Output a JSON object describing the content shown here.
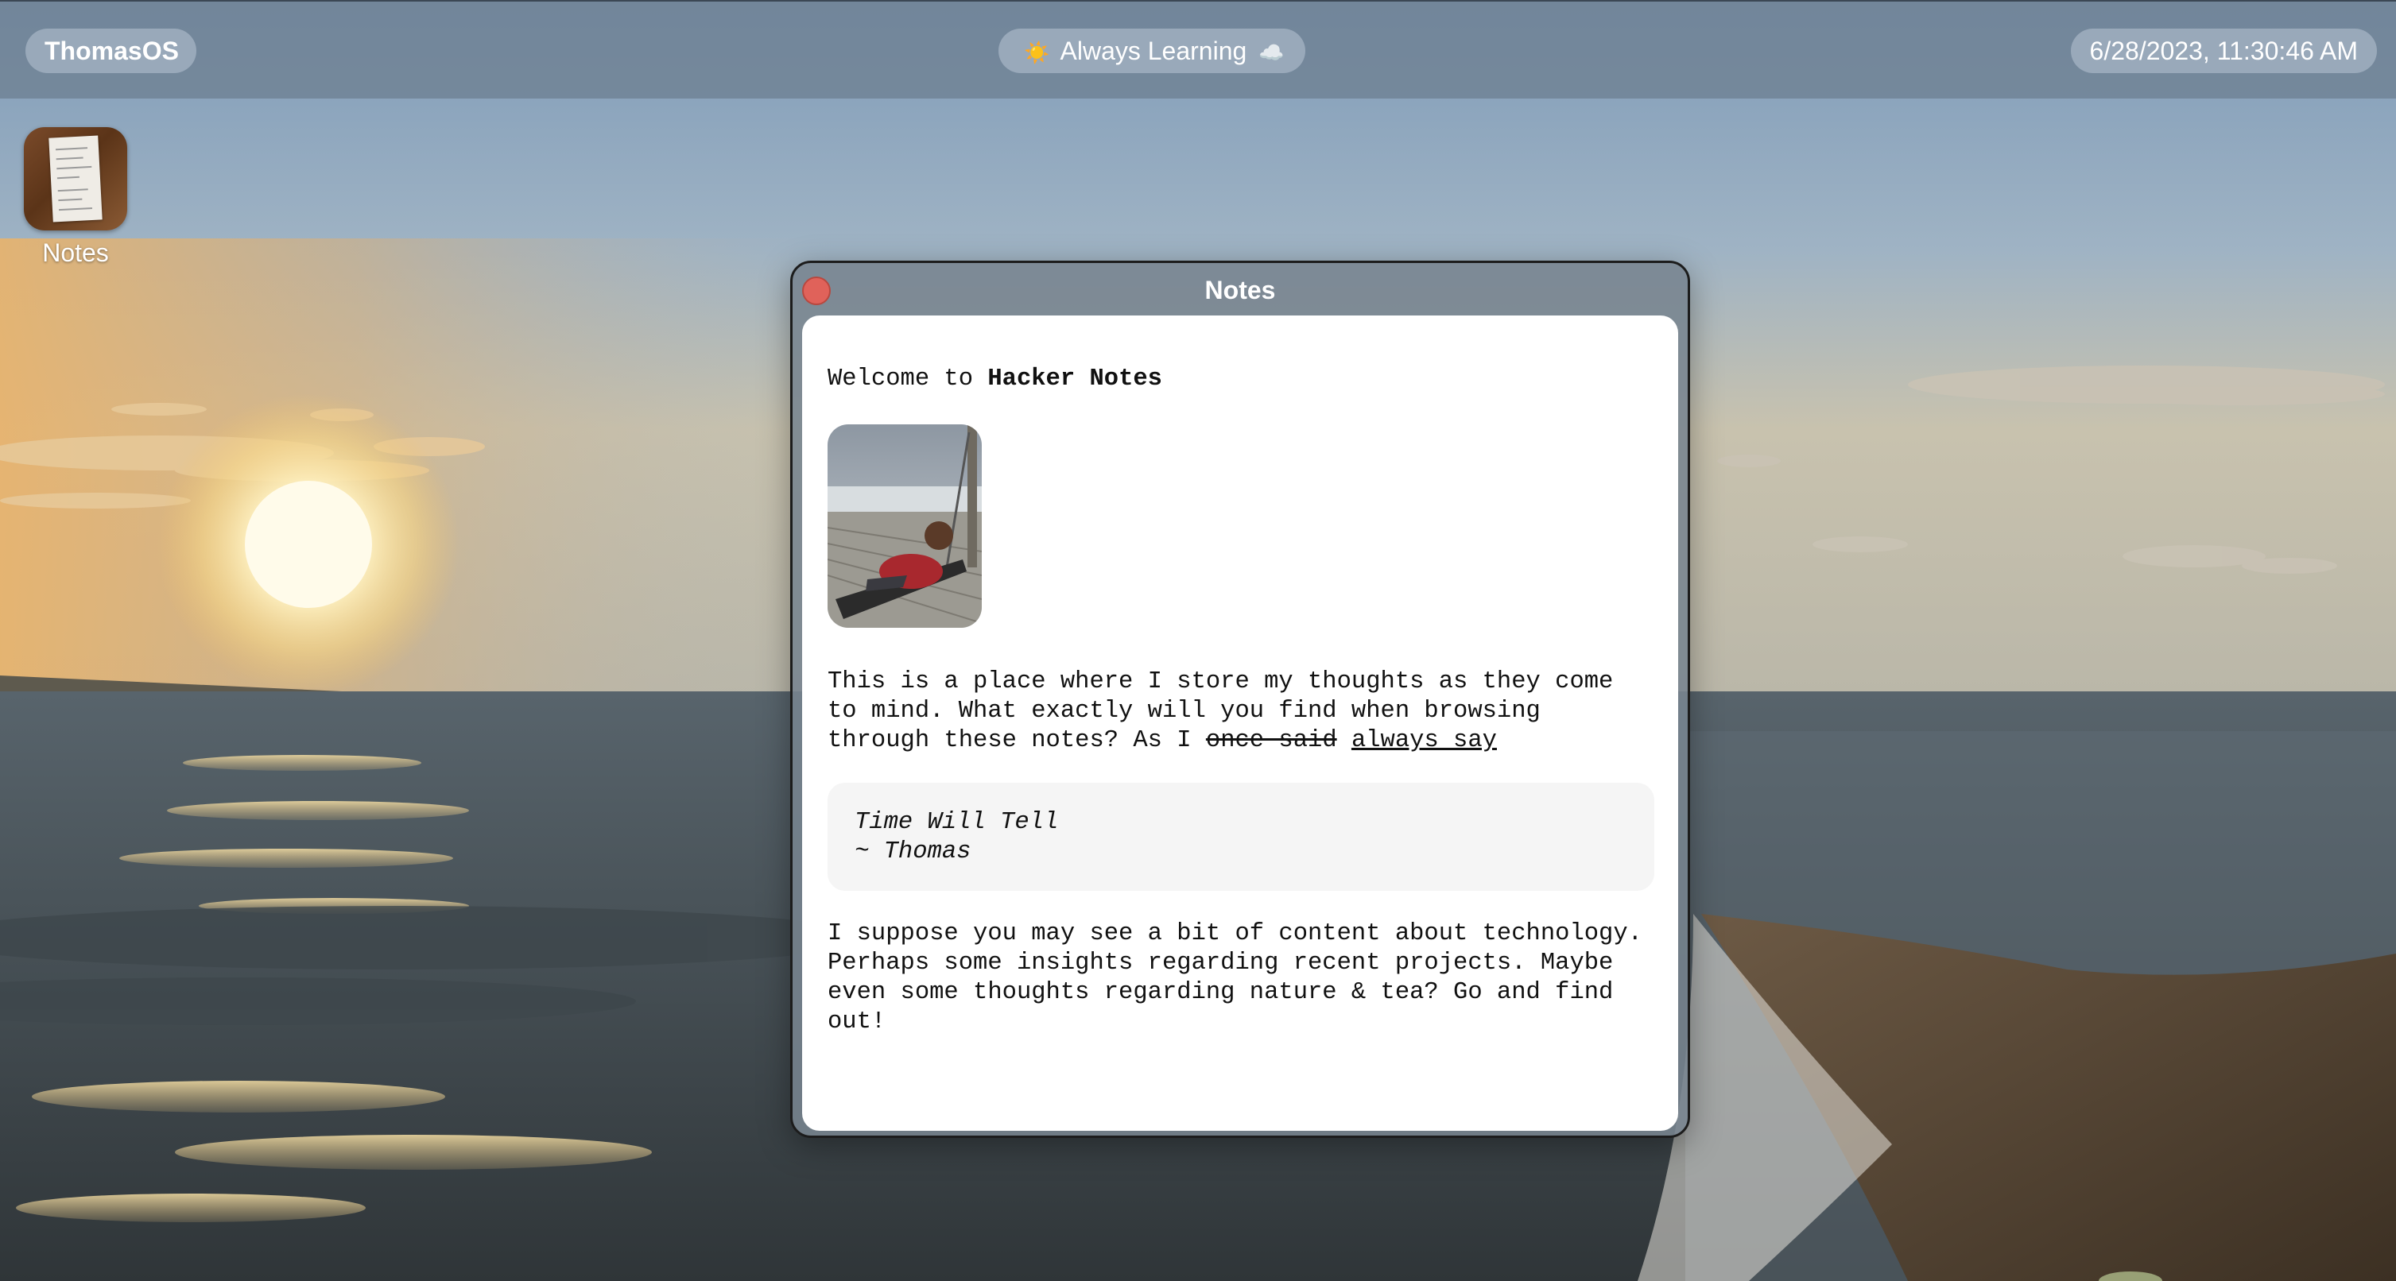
{
  "menubar": {
    "brand": "ThomasOS",
    "status": {
      "sun_icon": "sun-icon",
      "text": "Always Learning",
      "cloud_icon": "cloud-icon"
    },
    "clock": "6/28/2023, 11:30:46 AM"
  },
  "desktop": {
    "icons": [
      {
        "label": "Notes",
        "icon": "notes-app-icon"
      }
    ]
  },
  "window": {
    "title": "Notes",
    "close_icon": "close-icon",
    "content": {
      "welcome_prefix": "Welcome to ",
      "welcome_bold": "Hacker Notes",
      "photo": "profile-photo",
      "intro_text": "This is a place where I store my thoughts as they come to mind. What exactly will you find when browsing through these notes? As I ",
      "intro_strike": "once said",
      "intro_space": " ",
      "intro_underline": "always say",
      "quote_line1": "Time Will Tell",
      "quote_line2": "~ Thomas",
      "outro_text": "I suppose you may see a bit of content about technology. Perhaps some insights regarding recent projects. Maybe even some thoughts regarding nature & tea? Go and find out!"
    }
  },
  "colors": {
    "menubar_bg": "#6e8092",
    "pill_bg": "#a0afc0",
    "close_button": "#e0625a",
    "quote_bg": "#f5f5f5"
  }
}
